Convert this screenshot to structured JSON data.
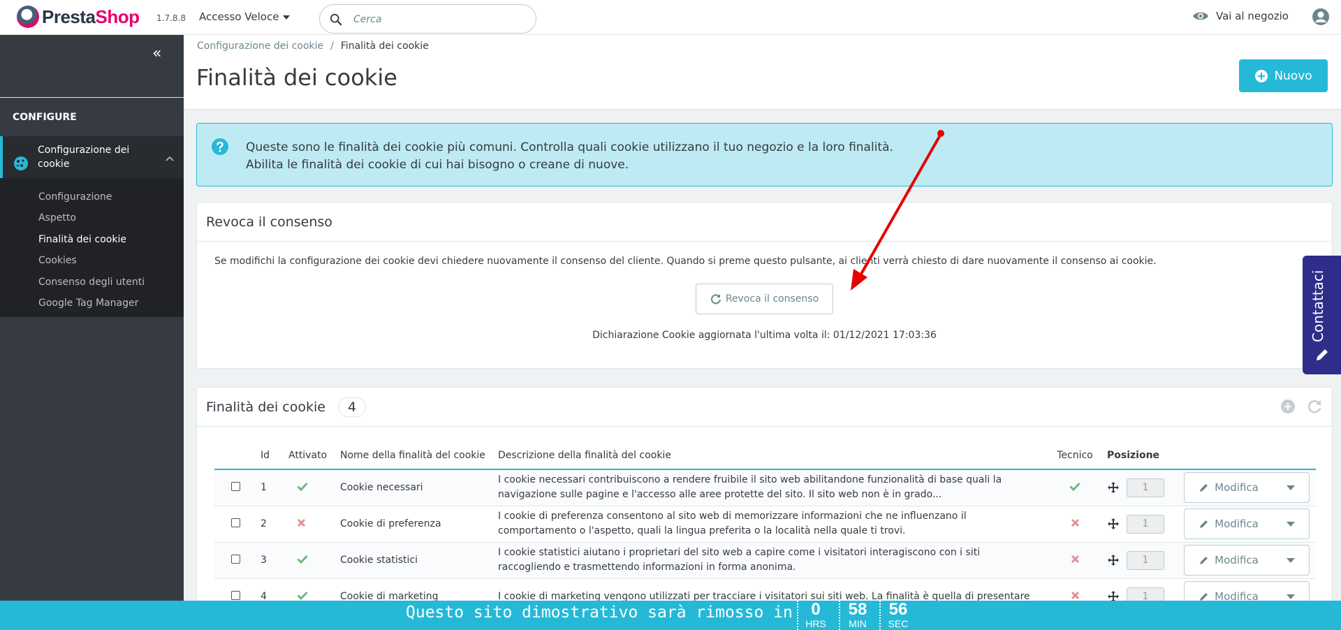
{
  "header": {
    "logo_presta": "Presta",
    "logo_shop": "Shop",
    "version": "1.7.8.8",
    "quick_access": "Accesso Veloce",
    "search_placeholder": "Cerca",
    "shop_link": "Vai al negozio"
  },
  "sidebar": {
    "section": "CONFIGURE",
    "active_module": "Configurazione dei cookie",
    "sub_items": [
      "Configurazione",
      "Aspetto",
      "Finalità dei cookie",
      "Cookies",
      "Consenso degli utenti",
      "Google Tag Manager"
    ],
    "current_sub_item": "Finalità dei cookie"
  },
  "breadcrumb": {
    "parent": "Configurazione dei cookie",
    "separator": "/",
    "current": "Finalità dei cookie"
  },
  "page": {
    "title": "Finalità dei cookie",
    "new_button": "Nuovo"
  },
  "info": {
    "line1": "Queste sono le finalità dei cookie più comuni. Controlla quali cookie utilizzano il tuo negozio e la loro finalità.",
    "line2": "Abilita le finalità dei cookie di cui hai bisogno o creane di nuove."
  },
  "revoke_panel": {
    "title": "Revoca il consenso",
    "text": "Se modifichi la configurazione dei cookie devi chiedere nuovamente il consenso del cliente. Quando si preme questo pulsante, ai clienti verrà chiesto di dare nuovamente il consenso ai cookie.",
    "button": "Revoca il consenso",
    "declaration": "Dichiarazione Cookie aggiornata l'ultima volta il: 01/12/2021 17:03:36"
  },
  "list_panel": {
    "title": "Finalità dei cookie",
    "count": "4",
    "columns": {
      "id": "Id",
      "enabled": "Attivato",
      "name": "Nome della finalità del cookie",
      "description": "Descrizione della finalità del cookie",
      "technical": "Tecnico",
      "position": "Posizione"
    },
    "edit_label": "Modifica",
    "rows": [
      {
        "id": "1",
        "enabled": true,
        "name": "Cookie necessari",
        "description": "I cookie necessari contribuiscono a rendere fruibile il sito web abilitandone funzionalità di base quali la navigazione sulle pagine e l'accesso alle aree protette del sito. Il sito web non è in grado...",
        "technical": true,
        "position": "1"
      },
      {
        "id": "2",
        "enabled": false,
        "name": "Cookie di preferenza",
        "description": "I cookie di preferenza consentono al sito web di memorizzare informazioni che ne influenzano il comportamento o l'aspetto, quali la lingua preferita o la località nella quale ti trovi.",
        "technical": false,
        "position": "1"
      },
      {
        "id": "3",
        "enabled": true,
        "name": "Cookie statistici",
        "description": "I cookie statistici aiutano i proprietari del sito web a capire come i visitatori interagiscono con i siti raccogliendo e trasmettendo informazioni in forma anonima.",
        "technical": false,
        "position": "1"
      },
      {
        "id": "4",
        "enabled": true,
        "name": "Cookie di marketing",
        "description": "I cookie di marketing vengono utilizzati per tracciare i visitatori sui siti web. La finalità è quella di presentare",
        "technical": false,
        "position": "1"
      }
    ]
  },
  "contact_tab": "Contattaci",
  "banner": {
    "text": "Questo sito dimostrativo sarà rimosso in",
    "hours": "0",
    "hours_unit": "HRS",
    "minutes": "58",
    "minutes_unit": "MIN",
    "seconds": "56",
    "seconds_unit": "SEC"
  },
  "colors": {
    "accent": "#25b9d7",
    "sidebar": "#363a41",
    "success": "#70b580",
    "danger": "#e08f95",
    "annotation": "#e60000"
  }
}
